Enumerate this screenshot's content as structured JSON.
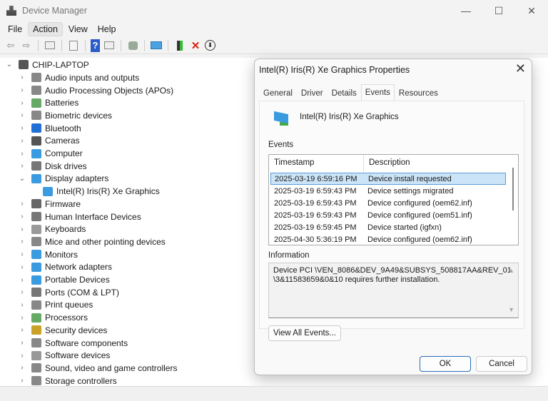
{
  "window": {
    "title": "Device Manager",
    "minimize": "—",
    "maximize": "☐",
    "close": "✕"
  },
  "menu": [
    "File",
    "Action",
    "View",
    "Help"
  ],
  "toolbar": {
    "back": "⇦",
    "forward": "⇨",
    "help": "?",
    "uninstall": "✕",
    "disable": "⬇"
  },
  "tree": {
    "root": "CHIP-LAPTOP",
    "items": [
      {
        "label": "Audio inputs and outputs",
        "color": "#888"
      },
      {
        "label": "Audio Processing Objects (APOs)",
        "color": "#888"
      },
      {
        "label": "Batteries",
        "color": "#6a6"
      },
      {
        "label": "Biometric devices",
        "color": "#888"
      },
      {
        "label": "Bluetooth",
        "color": "#1f6fd6"
      },
      {
        "label": "Cameras",
        "color": "#555"
      },
      {
        "label": "Computer",
        "color": "#3a9be0"
      },
      {
        "label": "Disk drives",
        "color": "#777"
      },
      {
        "label": "Display adapters",
        "color": "#3a9be0",
        "expanded": true
      },
      {
        "label": "Intel(R) Iris(R) Xe Graphics",
        "color": "#3a9be0",
        "child": true
      },
      {
        "label": "Firmware",
        "color": "#666"
      },
      {
        "label": "Human Interface Devices",
        "color": "#777"
      },
      {
        "label": "Keyboards",
        "color": "#999"
      },
      {
        "label": "Mice and other pointing devices",
        "color": "#888"
      },
      {
        "label": "Monitors",
        "color": "#3a9be0"
      },
      {
        "label": "Network adapters",
        "color": "#3a9be0"
      },
      {
        "label": "Portable Devices",
        "color": "#3a9be0"
      },
      {
        "label": "Ports (COM & LPT)",
        "color": "#777"
      },
      {
        "label": "Print queues",
        "color": "#888"
      },
      {
        "label": "Processors",
        "color": "#6a6"
      },
      {
        "label": "Security devices",
        "color": "#c9a227"
      },
      {
        "label": "Software components",
        "color": "#888"
      },
      {
        "label": "Software devices",
        "color": "#999"
      },
      {
        "label": "Sound, video and game controllers",
        "color": "#888"
      },
      {
        "label": "Storage controllers",
        "color": "#888"
      }
    ]
  },
  "dialog": {
    "title": "Intel(R) Iris(R) Xe Graphics Properties",
    "close": "✕",
    "tabs": [
      "General",
      "Driver",
      "Details",
      "Events",
      "Resources"
    ],
    "device_name": "Intel(R) Iris(R) Xe Graphics",
    "events_label": "Events",
    "columns": [
      "Timestamp",
      "Description"
    ],
    "events": [
      {
        "ts": "2025-03-19 6:59:16 PM",
        "desc": "Device install requested"
      },
      {
        "ts": "2025-03-19 6:59:43 PM",
        "desc": "Device settings migrated"
      },
      {
        "ts": "2025-03-19 6:59:43 PM",
        "desc": "Device configured (oem62.inf)"
      },
      {
        "ts": "2025-03-19 6:59:43 PM",
        "desc": "Device configured (oem51.inf)"
      },
      {
        "ts": "2025-03-19 6:59:45 PM",
        "desc": "Device started (igfxn)"
      },
      {
        "ts": "2025-04-30 5:36:19 PM",
        "desc": "Device configured (oem62.inf)"
      }
    ],
    "information_label": "Information",
    "information": "Device PCI \\VEN_8086&DEV_9A49&SUBSYS_508817AA&REV_01\\3&11583659&0&10 requires further installation.",
    "view_all": "View All Events...",
    "ok": "OK",
    "cancel": "Cancel"
  }
}
